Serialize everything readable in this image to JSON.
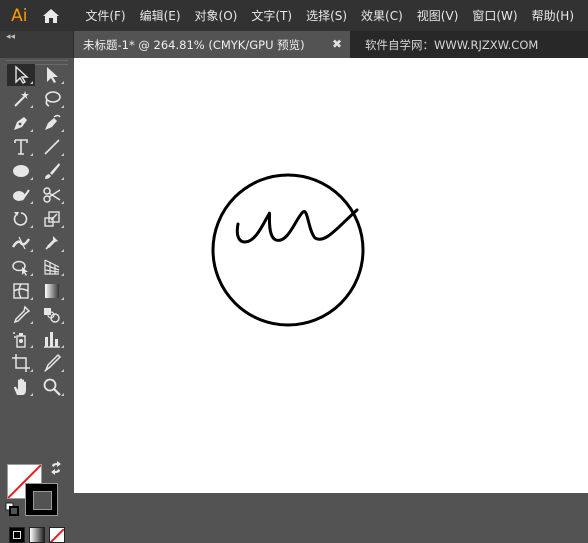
{
  "app": {
    "logo_text": "Ai"
  },
  "menu": {
    "items": [
      {
        "label": "文件(F)"
      },
      {
        "label": "编辑(E)"
      },
      {
        "label": "对象(O)"
      },
      {
        "label": "文字(T)"
      },
      {
        "label": "选择(S)"
      },
      {
        "label": "效果(C)"
      },
      {
        "label": "视图(V)"
      },
      {
        "label": "窗口(W)"
      },
      {
        "label": "帮助(H)"
      }
    ]
  },
  "tabs": {
    "collapse_glyph": "◂◂",
    "document_title": "未标题-1* @ 264.81% (CMYK/GPU 预览)",
    "close_glyph": "✖",
    "watermark": "软件自学网：WWW.RJZXW.COM"
  },
  "toolbar": {
    "tools": [
      {
        "icon": "selection-tool-icon",
        "selected": true
      },
      {
        "icon": "direct-selection-tool-icon"
      },
      {
        "icon": "magic-wand-tool-icon"
      },
      {
        "icon": "lasso-tool-icon"
      },
      {
        "icon": "pen-tool-icon"
      },
      {
        "icon": "curvature-tool-icon"
      },
      {
        "icon": "type-tool-icon"
      },
      {
        "icon": "line-segment-tool-icon"
      },
      {
        "icon": "ellipse-tool-icon"
      },
      {
        "icon": "paintbrush-tool-icon"
      },
      {
        "icon": "shaper-tool-icon"
      },
      {
        "icon": "scissors-tool-icon"
      },
      {
        "icon": "rotate-tool-icon"
      },
      {
        "icon": "scale-tool-icon"
      },
      {
        "icon": "width-tool-icon"
      },
      {
        "icon": "puppet-warp-tool-icon"
      },
      {
        "icon": "shape-builder-tool-icon"
      },
      {
        "icon": "perspective-grid-tool-icon"
      },
      {
        "icon": "mesh-tool-icon"
      },
      {
        "icon": "gradient-tool-icon"
      },
      {
        "icon": "eyedropper-tool-icon"
      },
      {
        "icon": "blend-tool-icon"
      },
      {
        "icon": "symbol-sprayer-tool-icon"
      },
      {
        "icon": "column-graph-tool-icon"
      },
      {
        "icon": "artboard-tool-icon"
      },
      {
        "icon": "slice-tool-icon"
      },
      {
        "icon": "hand-tool-icon"
      },
      {
        "icon": "zoom-tool-icon"
      }
    ],
    "fill": {
      "color": "none"
    },
    "stroke": {
      "color": "#000000"
    }
  },
  "canvas": {
    "background": "#ffffff",
    "artwork": {
      "shape": "circle",
      "stroke_color": "#000000",
      "fill": "none"
    }
  },
  "colors": {
    "accent_logo": "#ff9a00",
    "menubar_bg": "#323232",
    "panel_bg": "#535353",
    "none_slash": "#e02020"
  }
}
